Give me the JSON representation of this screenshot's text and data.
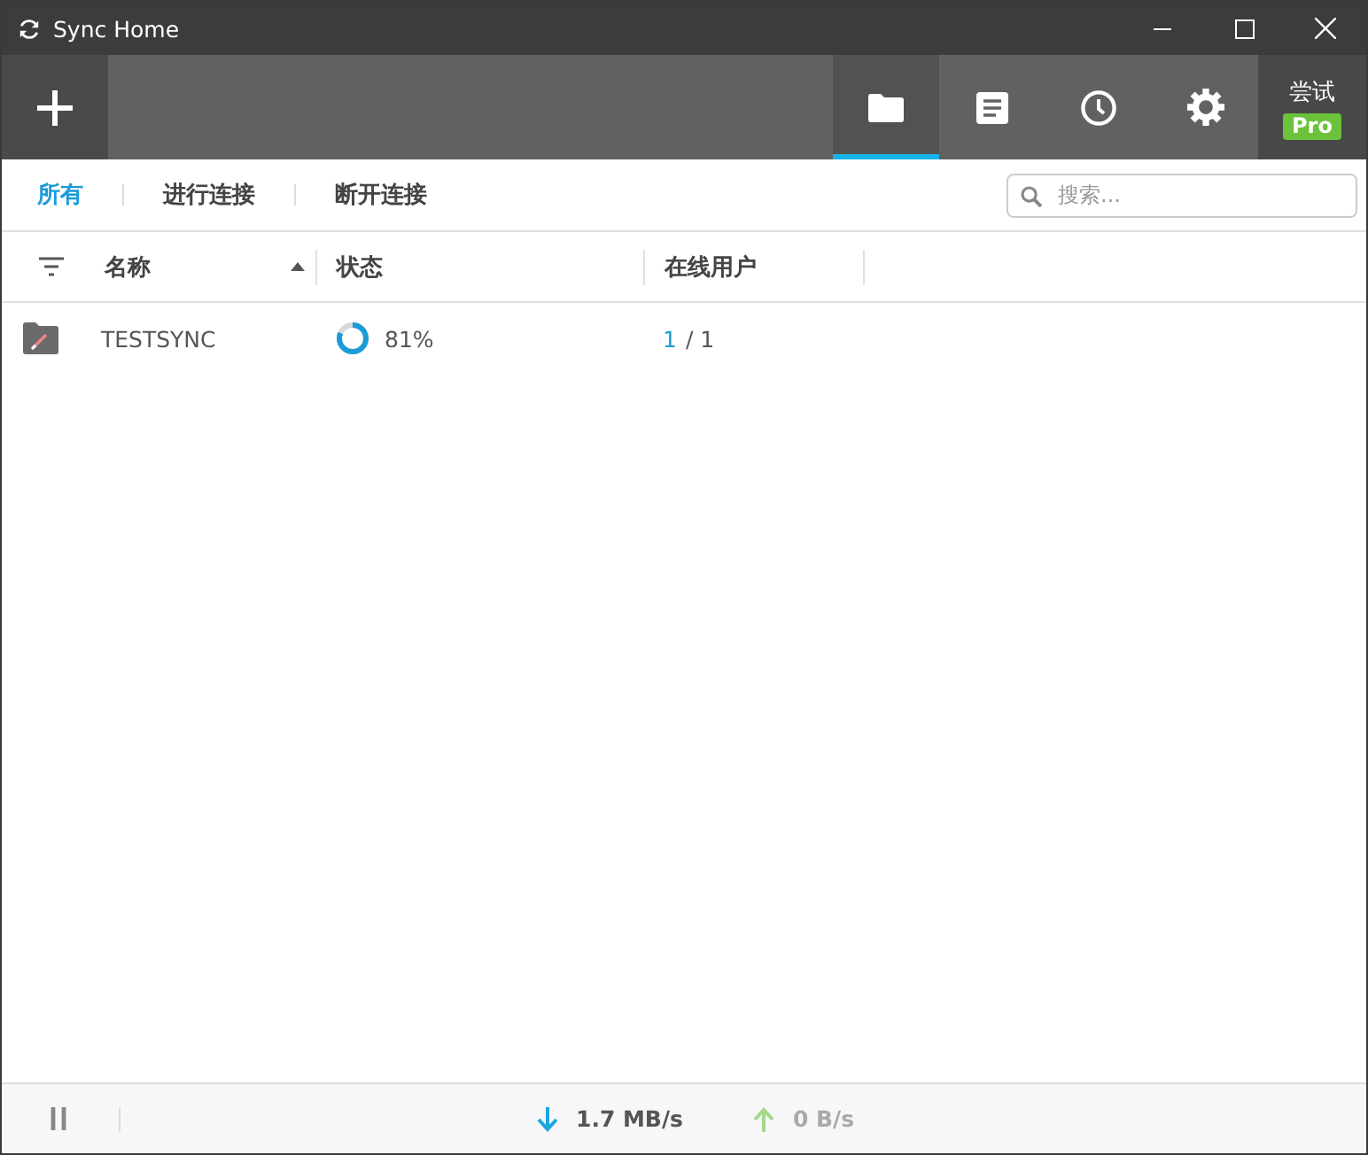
{
  "window": {
    "title": "Sync Home"
  },
  "toolbar": {
    "nav": [
      {
        "kind": "folder",
        "selected": true
      },
      {
        "kind": "list",
        "selected": false
      },
      {
        "kind": "clock",
        "selected": false
      },
      {
        "kind": "gear",
        "selected": false
      }
    ],
    "trial": {
      "label": "尝试",
      "badge": "Pro"
    }
  },
  "filters": [
    {
      "label": "所有",
      "selected": true
    },
    {
      "label": "进行连接",
      "selected": false
    },
    {
      "label": "断开连接",
      "selected": false
    }
  ],
  "search": {
    "placeholder": "搜索..."
  },
  "table": {
    "columns": [
      {
        "label": "名称",
        "sorted": true
      },
      {
        "label": "状态",
        "sorted": false
      },
      {
        "label": "在线用户",
        "sorted": false
      }
    ],
    "rows": [
      {
        "name": "TESTSYNC",
        "level": 0.81,
        "progress": "81%",
        "online": "1",
        "total": "/ 1"
      }
    ]
  },
  "status_bar": {
    "download": "1.7 MB/s",
    "upload": "0 B/s"
  }
}
